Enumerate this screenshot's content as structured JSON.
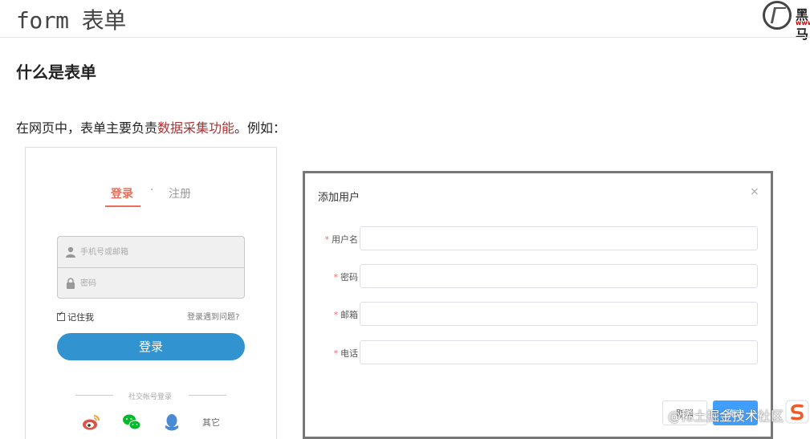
{
  "slide": {
    "title": "form 表单",
    "logo": {
      "brand": "黑马",
      "url": "www"
    }
  },
  "content": {
    "heading": "什么是表单",
    "paragraph_before": "在网页中，表单主要负责",
    "paragraph_highlight": "数据采集功能",
    "paragraph_after": "。例如："
  },
  "login_form": {
    "tab_login": "登录",
    "tab_separator": "·",
    "tab_register": "注册",
    "phone_placeholder": "手机号或邮箱",
    "password_placeholder": "密码",
    "remember_label": "记住我",
    "trouble_link": "登录遇到问题?",
    "login_button": "登录",
    "social_text": "社交帐号登录",
    "social_icons": [
      "weibo-icon",
      "wechat-icon",
      "qq-icon"
    ],
    "other_label": "其它",
    "colors": {
      "accent": "#ea6f5a",
      "button": "#3194d0"
    }
  },
  "dialog": {
    "title": "添加用户",
    "close_symbol": "×",
    "required_mark": "*",
    "fields": [
      {
        "label": "用户名"
      },
      {
        "label": "密码"
      },
      {
        "label": "邮箱"
      },
      {
        "label": "电话"
      }
    ],
    "cancel_button": "取消",
    "ok_button": "确定",
    "colors": {
      "primary": "#409eff",
      "required": "#f56c6c"
    }
  },
  "watermark": "@稀土掘金技术社区"
}
